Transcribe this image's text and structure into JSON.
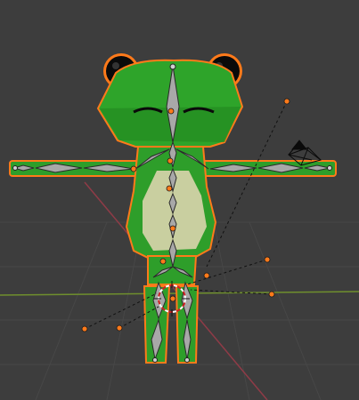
{
  "viewport": {
    "background": "#3d3d3d",
    "grid_color": "#4a4a4a",
    "x_axis_color": "#8f3b47",
    "y_axis_color": "#6f8f2d"
  },
  "model": {
    "body_color": "#2e9e2a",
    "belly_color": "#c9cfa0",
    "outline_color": "#ff7a1a",
    "eye_color": "#0a0a0a",
    "bone_color": "#a8a8a8",
    "bone_outline_color": "#2a2a2a",
    "control_point_color": "#ff7a1a"
  },
  "icons": {
    "camera": "camera-icon",
    "light": "light-icon",
    "cursor_3d": "3d-cursor-icon"
  }
}
